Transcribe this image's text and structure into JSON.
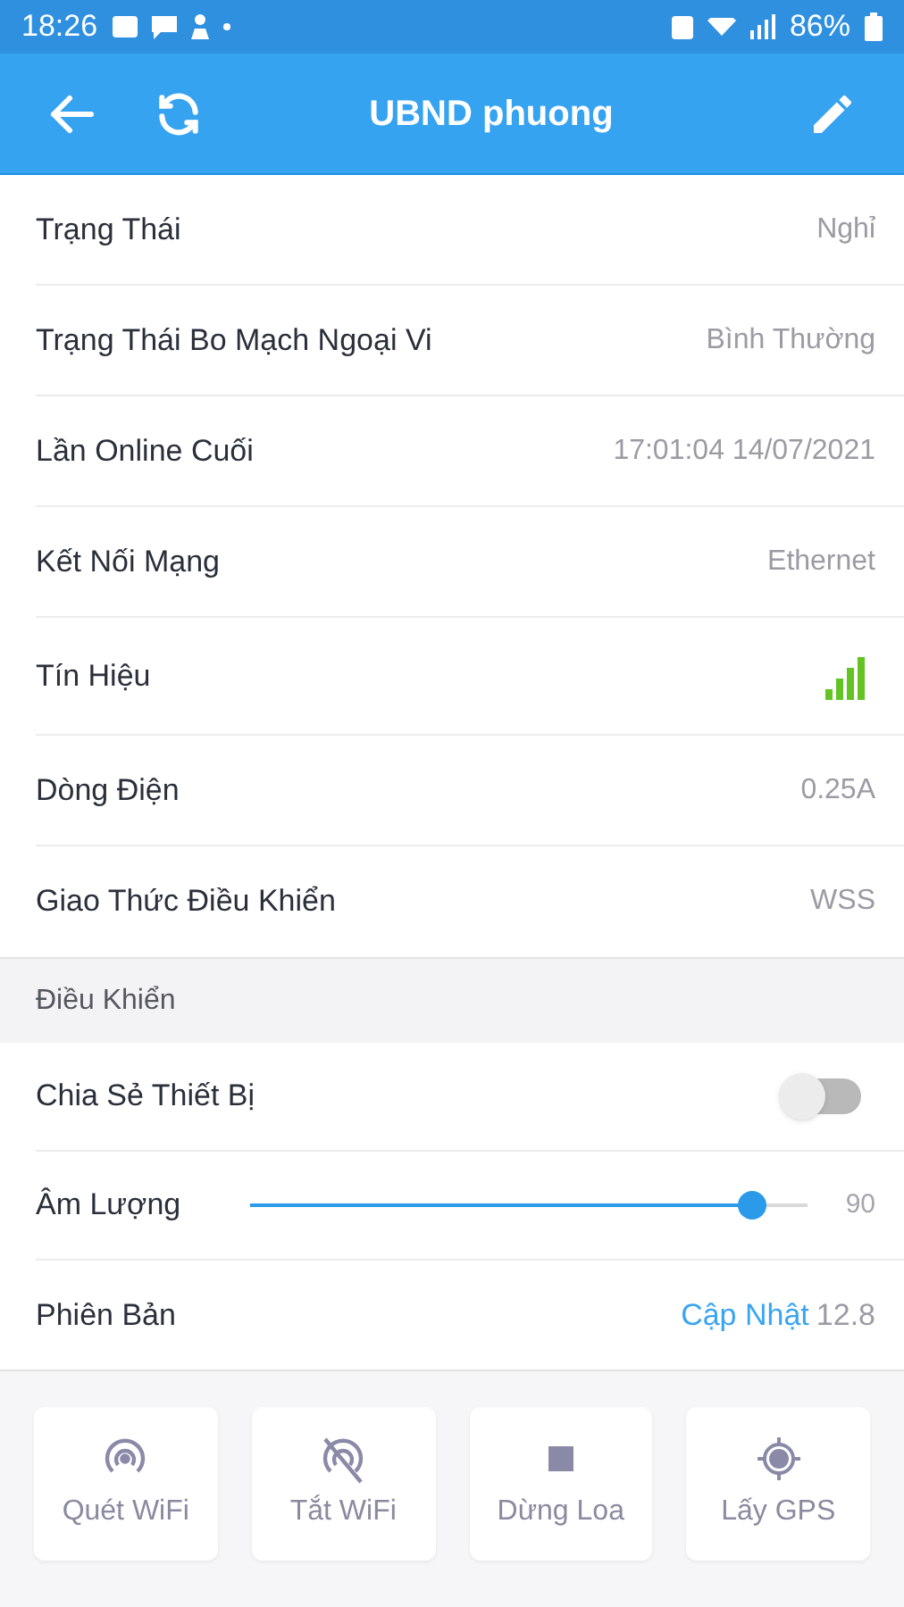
{
  "status_bar": {
    "time": "18:26",
    "battery": "86%"
  },
  "header": {
    "title": "UBND phuong"
  },
  "info_rows": [
    {
      "kind": "text",
      "label": "Trạng Thái",
      "value": "Nghỉ"
    },
    {
      "kind": "text",
      "label": "Trạng Thái Bo Mạch Ngoại Vi",
      "value": "Bình Thường"
    },
    {
      "kind": "text",
      "label": "Lần Online Cuối",
      "value": "17:01:04 14/07/2021"
    },
    {
      "kind": "text",
      "label": "Kết Nối Mạng",
      "value": "Ethernet"
    },
    {
      "kind": "signal",
      "label": "Tín Hiệu"
    },
    {
      "kind": "text",
      "label": "Dòng Điện",
      "value": "0.25A"
    },
    {
      "kind": "text",
      "label": "Giao Thức Điều Khiển",
      "value": "WSS"
    }
  ],
  "control_section": {
    "title": "Điều Khiển"
  },
  "controls": [
    {
      "kind": "toggle",
      "label": "Chia Sẻ Thiết Bị",
      "on": false
    },
    {
      "kind": "slider",
      "label": "Âm Lượng",
      "level": 0.9,
      "reading": "90"
    },
    {
      "kind": "version",
      "label": "Phiên Bản",
      "link": "Cập Nhật",
      "value": "12.8"
    }
  ],
  "actions": [
    {
      "kind": "wifi",
      "label": "Quét WiFi"
    },
    {
      "kind": "wifi-off",
      "label": "Tắt WiFi"
    },
    {
      "kind": "stop",
      "label": "Dừng Loa"
    },
    {
      "kind": "gps",
      "label": "Lấy GPS"
    }
  ]
}
